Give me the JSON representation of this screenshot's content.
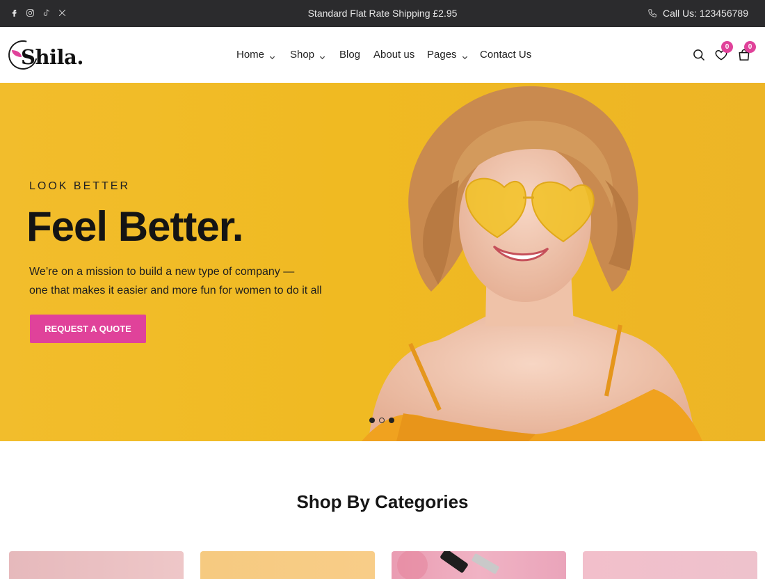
{
  "topbar": {
    "social": [
      "facebook-icon",
      "instagram-icon",
      "tiktok-icon",
      "x-icon"
    ],
    "shipping": "Standard Flat Rate Shipping £2.95",
    "call": "Call Us: 123456789"
  },
  "header": {
    "logo": "Shila.",
    "nav": [
      {
        "label": "Home",
        "dropdown": true
      },
      {
        "label": "Shop",
        "dropdown": true
      },
      {
        "label": "Blog",
        "dropdown": false
      },
      {
        "label": "About us",
        "dropdown": false
      },
      {
        "label": "Pages",
        "dropdown": true
      },
      {
        "label": "Contact Us",
        "dropdown": false
      }
    ],
    "wishlist_count": "0",
    "cart_count": "0"
  },
  "hero": {
    "kicker": "LOOK BETTER",
    "headline": "Feel Better.",
    "copy_line1": "We’re on a mission to build a new type of company —",
    "copy_line2": "one that makes it easier and more fun for women to do it all",
    "cta": "REQUEST A QUOTE",
    "slides": 3,
    "active_slide": 2
  },
  "categories": {
    "title": "Shop By Categories"
  },
  "colors": {
    "accent": "#e0429a",
    "hero_bg": "#f0ba22",
    "topbar_bg": "#2b2b2d"
  }
}
